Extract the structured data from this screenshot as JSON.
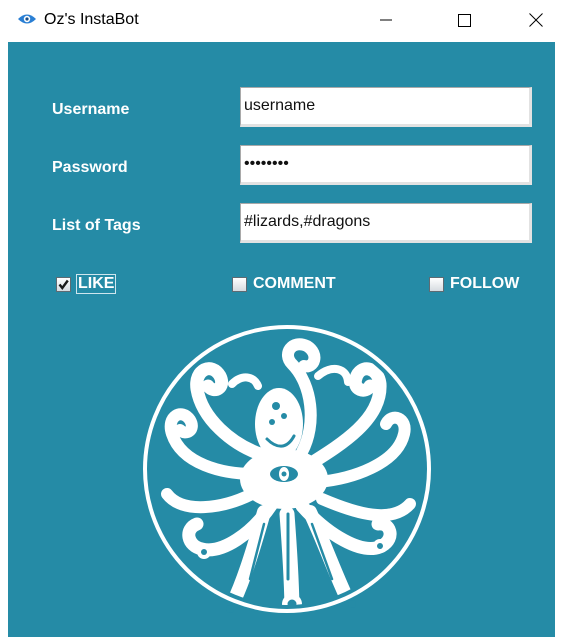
{
  "window": {
    "title": "Oz's InstaBot",
    "icons": {
      "app": "eye-icon",
      "minimize": "minimize-icon",
      "maximize": "maximize-icon",
      "close": "close-icon"
    }
  },
  "form": {
    "username": {
      "label": "Username",
      "value": "username"
    },
    "password": {
      "label": "Password",
      "value": "••••••••"
    },
    "tags": {
      "label": "List of Tags",
      "value": "#lizards,#dragons"
    }
  },
  "options": {
    "like": {
      "label": "LIKE",
      "checked": true
    },
    "comment": {
      "label": "COMMENT",
      "checked": false
    },
    "follow": {
      "label": "FOLLOW",
      "checked": false
    }
  },
  "logo": {
    "icon": "octopus-logo"
  },
  "colors": {
    "background": "#258ba6",
    "text": "#ffffff"
  }
}
